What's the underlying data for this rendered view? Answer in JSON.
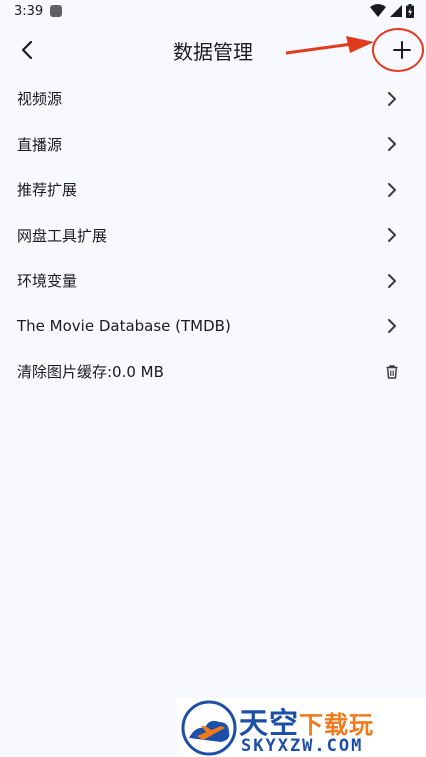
{
  "status": {
    "time": "3:39"
  },
  "header": {
    "title": "数据管理"
  },
  "menu": {
    "items": [
      {
        "label": "视频源",
        "trailing": "chevron"
      },
      {
        "label": "直播源",
        "trailing": "chevron"
      },
      {
        "label": "推荐扩展",
        "trailing": "chevron"
      },
      {
        "label": "网盘工具扩展",
        "trailing": "chevron"
      },
      {
        "label": "环境变量",
        "trailing": "chevron"
      },
      {
        "label": "The Movie Database (TMDB)",
        "trailing": "chevron"
      },
      {
        "label": "清除图片缓存:0.0 MB",
        "trailing": "trash"
      }
    ]
  },
  "watermark": {
    "title_main": "天空",
    "title_accent": "下载玩",
    "url": "SKYXZW.COM"
  },
  "colors": {
    "annotation": "#e23a1f",
    "watermark_blue": "#1e4fa8",
    "watermark_orange": "#f07a1a"
  }
}
